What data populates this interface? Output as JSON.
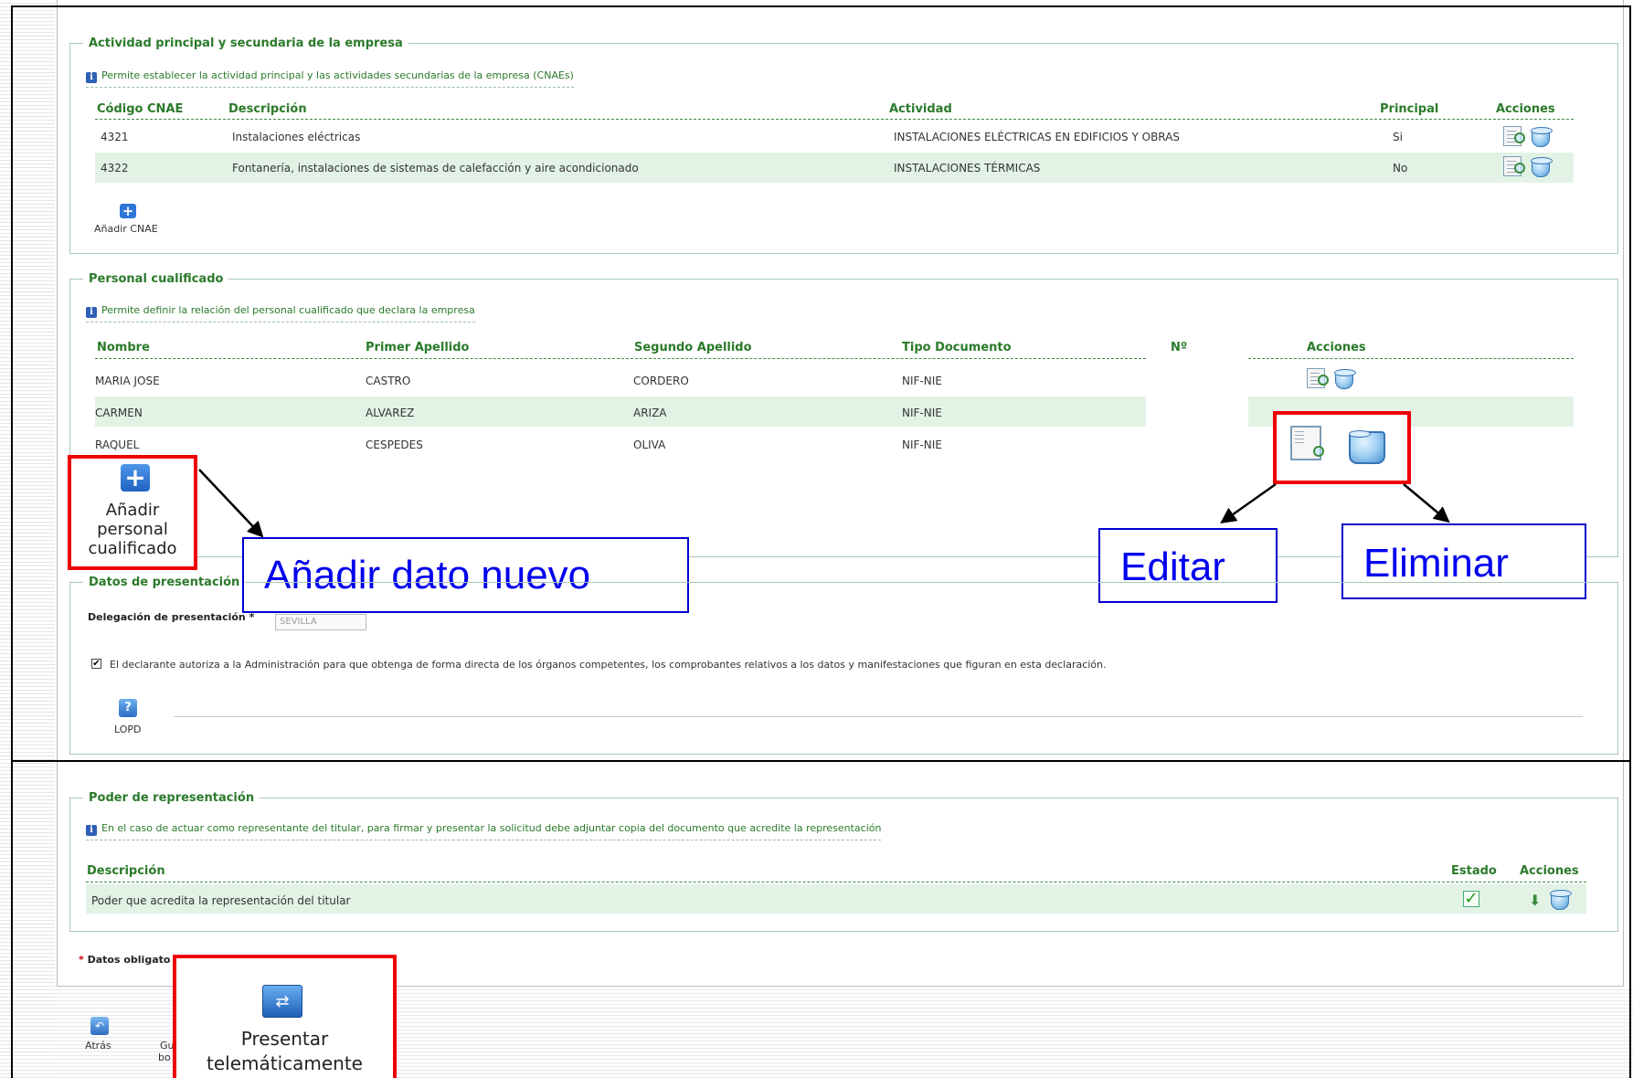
{
  "actividad": {
    "legend": "Actividad principal y secundaria de la empresa",
    "info": "Permite establecer la actividad principal y las actividades secundarias de la empresa (CNAEs)",
    "headers": {
      "codigo": "Código CNAE",
      "descripcion": "Descripción",
      "actividad": "Actividad",
      "principal": "Principal",
      "acciones": "Acciones"
    },
    "rows": [
      {
        "codigo": "4321",
        "descripcion": "Instalaciones eléctricas",
        "actividad": "INSTALACIONES ELÉCTRICAS EN EDIFICIOS Y OBRAS",
        "principal": "Si"
      },
      {
        "codigo": "4322",
        "descripcion": "Fontanería, instalaciones de sistemas de calefacción y aire acondicionado",
        "actividad": "INSTALACIONES TÉRMICAS",
        "principal": "No"
      }
    ],
    "add_label": "Añadir CNAE"
  },
  "personal": {
    "legend": "Personal cualificado",
    "info": "Permite definir la relación del personal cualificado que declara la empresa",
    "headers": {
      "nombre": "Nombre",
      "primer": "Primer Apellido",
      "segundo": "Segundo Apellido",
      "tipo": "Tipo Documento",
      "num": "Nº",
      "acciones": "Acciones"
    },
    "rows": [
      {
        "nombre": "MARIA JOSE",
        "primer": "CASTRO",
        "segundo": "CORDERO",
        "tipo": "NIF-NIE"
      },
      {
        "nombre": "CARMEN",
        "primer": "ALVAREZ",
        "segundo": "ARIZA",
        "tipo": "NIF-NIE"
      },
      {
        "nombre": "RAQUEL",
        "primer": "CESPEDES",
        "segundo": "OLIVA",
        "tipo": "NIF-NIE"
      }
    ],
    "add_lines": [
      "Añadir",
      "personal",
      "cualificado"
    ]
  },
  "annotations": {
    "add_new": "Añadir dato nuevo",
    "edit": "Editar",
    "delete": "Eliminar"
  },
  "presentacion": {
    "legend": "Datos de presentación",
    "delegacion_label": "Delegación de presentación *",
    "delegacion_value": "SEVILLA",
    "autoriza_text": "El declarante autoriza a la Administración para que obtenga de forma directa de los órganos competentes, los comprobantes relativos a los datos y manifestaciones que figuran en esta declaración.",
    "lopd_label": "LOPD"
  },
  "poder": {
    "legend": "Poder de representación",
    "info": "En el caso de actuar como representante del titular, para firmar y presentar la solicitud debe adjuntar copia del documento que acredite la representación",
    "headers": {
      "descripcion": "Descripción",
      "estado": "Estado",
      "acciones": "Acciones"
    },
    "rows": [
      {
        "descripcion": "Poder que acredita la representación del titular"
      }
    ]
  },
  "footer": {
    "obligatorios": "Datos obligato",
    "atras": "Atrás",
    "gu": "Gu",
    "bo": "bo",
    "present_lines": [
      "Presentar",
      "telemáticamente"
    ]
  },
  "colors": {
    "accent": "#2a7a2a",
    "row_highlight": "#e2f3e6",
    "annotation_red": "#ee0000",
    "annotation_blue": "#0000ee"
  }
}
